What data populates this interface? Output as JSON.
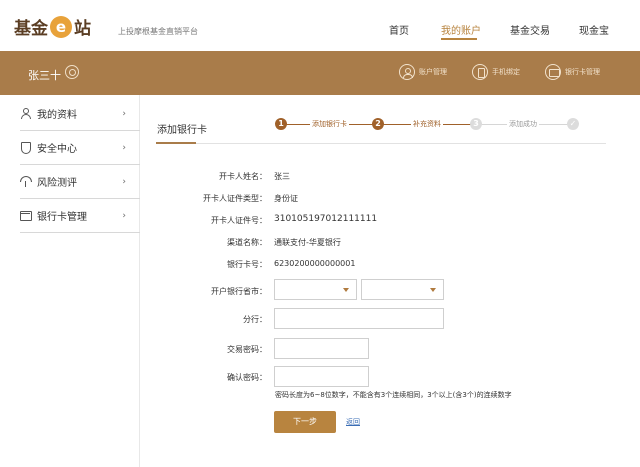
{
  "header": {
    "logo_part1": "基金",
    "logo_mark": "e",
    "logo_part2": "站",
    "tagline": "上投摩根基金直销平台",
    "nav": [
      "首页",
      "我的账户",
      "基金交易",
      "现金宝"
    ],
    "active_nav": "我的账户"
  },
  "band": {
    "username": "张三十",
    "links": [
      "账户管理",
      "手机绑定",
      "银行卡管理"
    ]
  },
  "sidebar": {
    "items": [
      {
        "label": "我的资料",
        "icon": "user-icon"
      },
      {
        "label": "安全中心",
        "icon": "shield-icon"
      },
      {
        "label": "风险测评",
        "icon": "umbrella-icon"
      },
      {
        "label": "银行卡管理",
        "icon": "card-icon"
      }
    ],
    "arrow": "›"
  },
  "main": {
    "title": "添加银行卡",
    "steps": [
      {
        "num": "1",
        "label": "添加银行卡"
      },
      {
        "num": "2",
        "label": "补充资料"
      },
      {
        "num": "3",
        "label": "添加成功"
      },
      {
        "num": "✓",
        "label": ""
      }
    ],
    "form": {
      "holder_name_label": "开卡人姓名：",
      "holder_name": "张三",
      "id_type_label": "开卡人证件类型：",
      "id_type": "身份证",
      "id_no_label": "开卡人证件号：",
      "id_no": "310105197012111111",
      "channel_label": "渠道名称：",
      "channel": "通联支付-华夏银行",
      "card_no_label": "银行卡号：",
      "card_no": "6230200000000001",
      "province_label": "开户银行省市：",
      "branch_label": "分行：",
      "trade_pwd_label": "交易密码：",
      "confirm_pwd_label": "确认密码：",
      "pwd_hint": "密码长度为6~8位数字，不能含有3个连续相同，3个以上(含3个)的连续数字",
      "next_label": "下一步",
      "back_label": "返回"
    }
  },
  "colors": {
    "brand_brown": "#a97c4a",
    "accent_gold": "#b8843f",
    "step_active": "#a0612a",
    "link_blue": "#3a6db5"
  }
}
